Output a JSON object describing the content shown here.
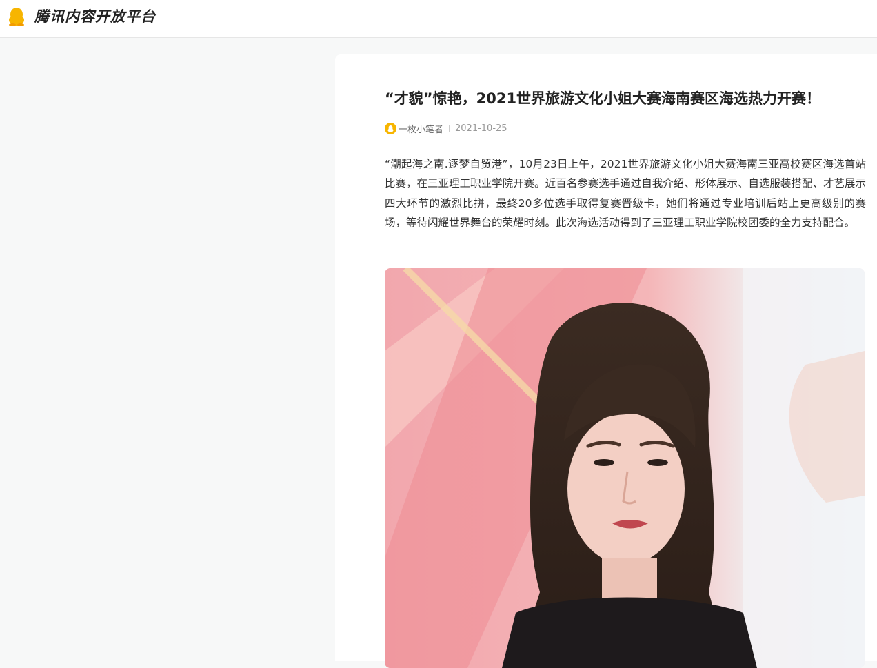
{
  "header": {
    "brand": "腾讯内容开放平台",
    "logo_icon": "penguin-icon",
    "brand_color": "#f7b500"
  },
  "article": {
    "title": "“才貌”惊艳，2021世界旅游文化小姐大赛海南赛区海选热力开赛！",
    "author": "一枚小笔者",
    "date": "2021-10-25",
    "body": "“潮起海之南.逐梦自贸港”，10月23日上午，2021世界旅游文化小姐大赛海南三亚高校赛区海选首站比赛，在三亚理工职业学院开赛。近百名参赛选手通过自我介绍、形体展示、自选服装搭配、才艺展示四大环节的激烈比拼，最终20多位选手取得复赛晋级卡，她们将通过专业培训后站上更高级别的赛场，等待闪耀世界舞台的荣耀时刻。此次海选活动得到了三亚理工职业学院校团委的全力支持配合。",
    "image_icon": "article-photo"
  }
}
